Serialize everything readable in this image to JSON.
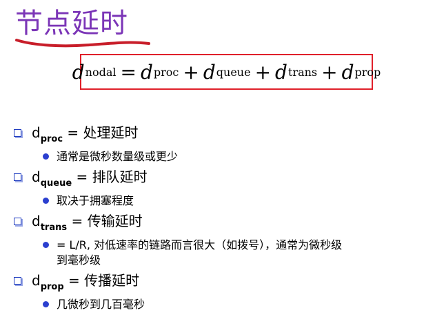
{
  "title": "节点延时",
  "accent_colors": {
    "title": "#7b35b7",
    "underline": "#c81e2a",
    "box_border": "#e0202a",
    "bullet": "#2b3fcf"
  },
  "formula": {
    "lhs": {
      "var": "d",
      "sub": "nodal"
    },
    "eq": "=",
    "plus": "+",
    "terms": [
      {
        "var": "d",
        "sub": "proc"
      },
      {
        "var": "d",
        "sub": "queue"
      },
      {
        "var": "d",
        "sub": "trans"
      },
      {
        "var": "d",
        "sub": "prop"
      }
    ]
  },
  "items": [
    {
      "d": "d",
      "sub": "proc",
      "rest": " = 处理延时",
      "detail": [
        "通常是微秒数量级或更少"
      ]
    },
    {
      "d": "d",
      "sub": "queue",
      "rest": " = 排队延时",
      "detail": [
        "取决于拥塞程度"
      ]
    },
    {
      "d": "d",
      "sub": "trans",
      "rest": " = 传输延时",
      "detail": [
        "= L/R, 对低速率的链路而言很大（如拨号），通常为微秒级",
        "到毫秒级"
      ]
    },
    {
      "d": "d",
      "sub": "prop",
      "rest": " = 传播延时",
      "detail": [
        "几微秒到几百毫秒"
      ]
    }
  ]
}
